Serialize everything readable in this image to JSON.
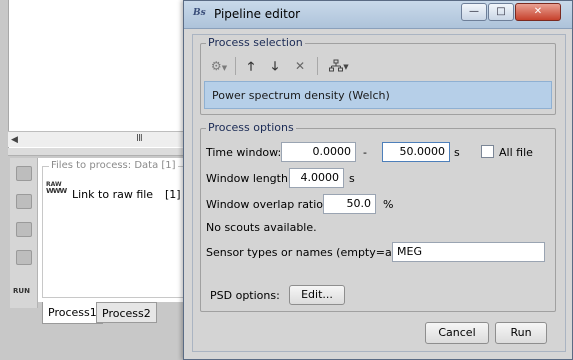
{
  "background_window": {
    "scroll_grip": "III",
    "files_panel": {
      "title": "Files to process: Data [1]",
      "raw_icon_text": "RAW",
      "raw_icon_wave": "WWW",
      "item_label": "Link to raw file",
      "item_count": "[1]"
    },
    "run_label": "RUN",
    "tabs": [
      "Process1",
      "Process2"
    ]
  },
  "dialog": {
    "title": "Pipeline editor",
    "logo_text": "Bs",
    "window_buttons": {
      "minimize": "—",
      "maximize": "□",
      "close": "✕"
    },
    "process_selection": {
      "title": "Process selection",
      "toolbar_icons": [
        "gear-icon",
        "arrow-up-icon",
        "arrow-down-icon",
        "delete-icon",
        "tree-icon"
      ],
      "items": [
        "Power spectrum density (Welch)"
      ]
    },
    "process_options": {
      "title": "Process options",
      "time_window": {
        "label": "Time window:",
        "start": "0.0000",
        "separator": "-",
        "end": "50.0000",
        "unit": "s",
        "all_file_label": "All file",
        "all_file_checked": false
      },
      "window_length": {
        "label": "Window length:",
        "value": "4.0000",
        "unit": "s"
      },
      "window_overlap": {
        "label": "Window overlap ratio:",
        "value": "50.0",
        "unit": "%"
      },
      "scouts_message": "No scouts available.",
      "sensor_types": {
        "label": "Sensor types or names (empty=all):",
        "value": "MEG"
      },
      "psd_options": {
        "label": "PSD options:",
        "button": "Edit..."
      }
    },
    "buttons": {
      "cancel": "Cancel",
      "run": "Run"
    }
  },
  "colors": {
    "titlebar": "#aec3da",
    "selection_highlight": "#b6cfe8",
    "group_title": "#1a2a55"
  }
}
